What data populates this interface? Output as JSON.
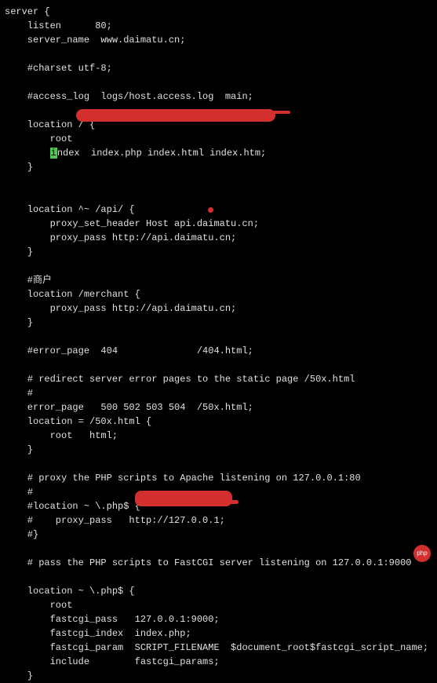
{
  "config": {
    "lines": [
      "server {",
      "    listen      80;",
      "    server_name  www.daimatu.cn;",
      "",
      "    #charset utf-8;",
      "",
      "    #access_log  logs/host.access.log  main;",
      "",
      "    location / {",
      "        root                                  ",
      "        index  index.php index.html index.htm;",
      "    }",
      "",
      "",
      "    location ^~ /api/ {",
      "        proxy_set_header Host api.daimatu.cn;",
      "        proxy_pass http://api.daimatu.cn;",
      "    }",
      "",
      "    #商户",
      "    location /merchant {",
      "        proxy_pass http://api.daimatu.cn;",
      "    }",
      "",
      "    #error_page  404              /404.html;",
      "",
      "    # redirect server error pages to the static page /50x.html",
      "    #",
      "    error_page   500 502 503 504  /50x.html;",
      "    location = /50x.html {",
      "        root   html;",
      "    }",
      "",
      "    # proxy the PHP scripts to Apache listening on 127.0.0.1:80",
      "    #",
      "    #location ~ \\.php$ {",
      "    #    proxy_pass   http://127.0.0.1;",
      "    #}",
      "",
      "    # pass the PHP scripts to FastCGI server listening on 127.0.0.1:9000",
      "",
      "    location ~ \\.php$ {",
      "        root           ",
      "        fastcgi_pass   127.0.0.1:9000;",
      "        fastcgi_index  index.php;",
      "        fastcgi_param  SCRIPT_FILENAME  $document_root$fastcgi_script_name;",
      "        include        fastcgi_params;",
      "    }"
    ],
    "cursor_line": 10,
    "cursor_col": 8,
    "cursor_char": "i",
    "badge_text": "php"
  }
}
